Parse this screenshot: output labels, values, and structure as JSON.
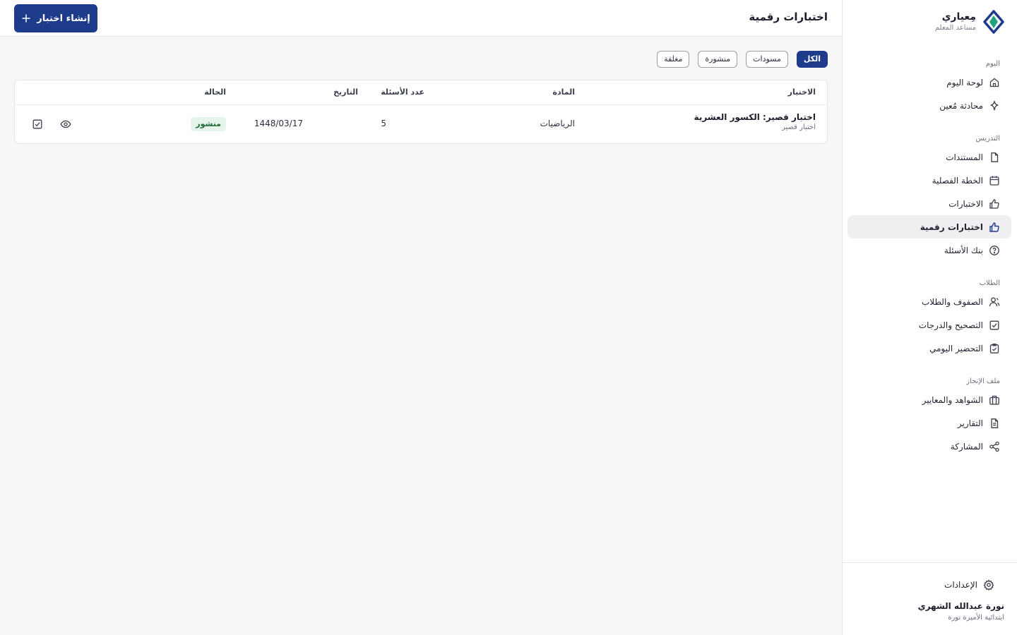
{
  "brand": {
    "name": "مِعياري",
    "subtitle": "مساعد المعلم"
  },
  "nav": {
    "groups": [
      {
        "title": "اليوم",
        "items": [
          {
            "label": "لوحة اليوم",
            "icon": "home-icon"
          },
          {
            "label": "محادثة مُعين",
            "icon": "sparkle-icon"
          }
        ]
      },
      {
        "title": "التدريس",
        "items": [
          {
            "label": "المستندات",
            "icon": "document-icon"
          },
          {
            "label": "الخطة الفصلية",
            "icon": "calendar-icon"
          },
          {
            "label": "الاختبارات",
            "icon": "thumbs-up-icon"
          },
          {
            "label": "اختبارات رقمية",
            "icon": "thumbs-up-icon",
            "active": true
          },
          {
            "label": "بنك الأسئلة",
            "icon": "question-circle-icon"
          }
        ]
      },
      {
        "title": "الطلاب",
        "items": [
          {
            "label": "الصفوف والطلاب",
            "icon": "user-icon"
          },
          {
            "label": "التصحيح والدرجات",
            "icon": "checkbox-icon"
          },
          {
            "label": "التحضير اليومي",
            "icon": "clipboard-check-icon"
          }
        ]
      },
      {
        "title": "ملف الإنجاز",
        "items": [
          {
            "label": "الشواهد والمعايير",
            "icon": "briefcase-icon"
          },
          {
            "label": "التقارير",
            "icon": "file-text-icon"
          },
          {
            "label": "المشاركة",
            "icon": "share-icon"
          }
        ]
      }
    ]
  },
  "settings": {
    "label": "الإعدادات"
  },
  "user": {
    "name": "نورة عبدالله الشهري",
    "school": "ابتدائية الأميرة نورة"
  },
  "header": {
    "title": "اختبارات رقمية",
    "create_label": "إنشاء اختبار"
  },
  "filters": [
    {
      "label": "الكل",
      "active": true
    },
    {
      "label": "مسودات"
    },
    {
      "label": "منشورة"
    },
    {
      "label": "مغلقة"
    }
  ],
  "table": {
    "columns": {
      "quiz": "الاختبار",
      "subject": "المادة",
      "questions": "عدد الأسئلة",
      "date": "التاريخ",
      "status": "الحالة"
    },
    "rows": [
      {
        "title": "اختبار قصير: الكسور العشرية",
        "type": "اختبار قصير",
        "subject": "الرياضيات",
        "questions": "5",
        "date": "1448/03/17",
        "status": "منشور"
      }
    ]
  },
  "colors": {
    "accent": "#1e3a8a",
    "status_published_bg": "#e6f3ea",
    "status_published_text": "#1d6b3a",
    "logo_green": "#1fa37a"
  }
}
